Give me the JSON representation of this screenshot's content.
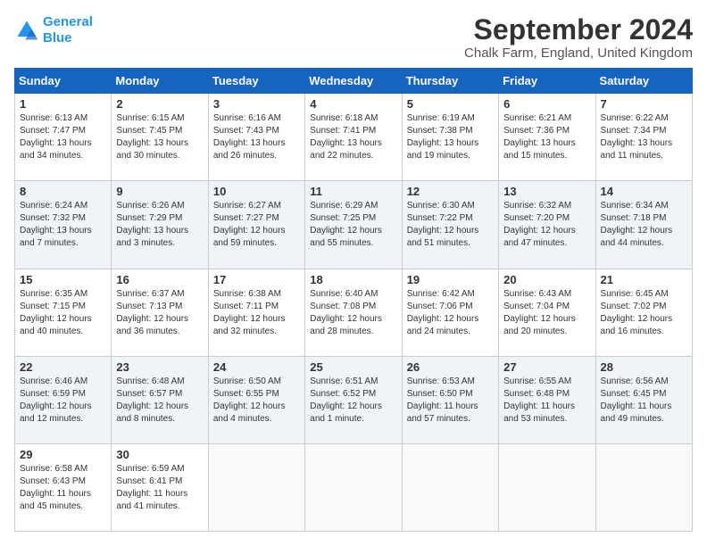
{
  "logo": {
    "line1": "General",
    "line2": "Blue"
  },
  "title": "September 2024",
  "location": "Chalk Farm, England, United Kingdom",
  "weekdays": [
    "Sunday",
    "Monday",
    "Tuesday",
    "Wednesday",
    "Thursday",
    "Friday",
    "Saturday"
  ],
  "rows": [
    [
      {
        "day": "1",
        "info": "Sunrise: 6:13 AM\nSunset: 7:47 PM\nDaylight: 13 hours\nand 34 minutes."
      },
      {
        "day": "2",
        "info": "Sunrise: 6:15 AM\nSunset: 7:45 PM\nDaylight: 13 hours\nand 30 minutes."
      },
      {
        "day": "3",
        "info": "Sunrise: 6:16 AM\nSunset: 7:43 PM\nDaylight: 13 hours\nand 26 minutes."
      },
      {
        "day": "4",
        "info": "Sunrise: 6:18 AM\nSunset: 7:41 PM\nDaylight: 13 hours\nand 22 minutes."
      },
      {
        "day": "5",
        "info": "Sunrise: 6:19 AM\nSunset: 7:38 PM\nDaylight: 13 hours\nand 19 minutes."
      },
      {
        "day": "6",
        "info": "Sunrise: 6:21 AM\nSunset: 7:36 PM\nDaylight: 13 hours\nand 15 minutes."
      },
      {
        "day": "7",
        "info": "Sunrise: 6:22 AM\nSunset: 7:34 PM\nDaylight: 13 hours\nand 11 minutes."
      }
    ],
    [
      {
        "day": "8",
        "info": "Sunrise: 6:24 AM\nSunset: 7:32 PM\nDaylight: 13 hours\nand 7 minutes."
      },
      {
        "day": "9",
        "info": "Sunrise: 6:26 AM\nSunset: 7:29 PM\nDaylight: 13 hours\nand 3 minutes."
      },
      {
        "day": "10",
        "info": "Sunrise: 6:27 AM\nSunset: 7:27 PM\nDaylight: 12 hours\nand 59 minutes."
      },
      {
        "day": "11",
        "info": "Sunrise: 6:29 AM\nSunset: 7:25 PM\nDaylight: 12 hours\nand 55 minutes."
      },
      {
        "day": "12",
        "info": "Sunrise: 6:30 AM\nSunset: 7:22 PM\nDaylight: 12 hours\nand 51 minutes."
      },
      {
        "day": "13",
        "info": "Sunrise: 6:32 AM\nSunset: 7:20 PM\nDaylight: 12 hours\nand 47 minutes."
      },
      {
        "day": "14",
        "info": "Sunrise: 6:34 AM\nSunset: 7:18 PM\nDaylight: 12 hours\nand 44 minutes."
      }
    ],
    [
      {
        "day": "15",
        "info": "Sunrise: 6:35 AM\nSunset: 7:15 PM\nDaylight: 12 hours\nand 40 minutes."
      },
      {
        "day": "16",
        "info": "Sunrise: 6:37 AM\nSunset: 7:13 PM\nDaylight: 12 hours\nand 36 minutes."
      },
      {
        "day": "17",
        "info": "Sunrise: 6:38 AM\nSunset: 7:11 PM\nDaylight: 12 hours\nand 32 minutes."
      },
      {
        "day": "18",
        "info": "Sunrise: 6:40 AM\nSunset: 7:08 PM\nDaylight: 12 hours\nand 28 minutes."
      },
      {
        "day": "19",
        "info": "Sunrise: 6:42 AM\nSunset: 7:06 PM\nDaylight: 12 hours\nand 24 minutes."
      },
      {
        "day": "20",
        "info": "Sunrise: 6:43 AM\nSunset: 7:04 PM\nDaylight: 12 hours\nand 20 minutes."
      },
      {
        "day": "21",
        "info": "Sunrise: 6:45 AM\nSunset: 7:02 PM\nDaylight: 12 hours\nand 16 minutes."
      }
    ],
    [
      {
        "day": "22",
        "info": "Sunrise: 6:46 AM\nSunset: 6:59 PM\nDaylight: 12 hours\nand 12 minutes."
      },
      {
        "day": "23",
        "info": "Sunrise: 6:48 AM\nSunset: 6:57 PM\nDaylight: 12 hours\nand 8 minutes."
      },
      {
        "day": "24",
        "info": "Sunrise: 6:50 AM\nSunset: 6:55 PM\nDaylight: 12 hours\nand 4 minutes."
      },
      {
        "day": "25",
        "info": "Sunrise: 6:51 AM\nSunset: 6:52 PM\nDaylight: 12 hours\nand 1 minute."
      },
      {
        "day": "26",
        "info": "Sunrise: 6:53 AM\nSunset: 6:50 PM\nDaylight: 11 hours\nand 57 minutes."
      },
      {
        "day": "27",
        "info": "Sunrise: 6:55 AM\nSunset: 6:48 PM\nDaylight: 11 hours\nand 53 minutes."
      },
      {
        "day": "28",
        "info": "Sunrise: 6:56 AM\nSunset: 6:45 PM\nDaylight: 11 hours\nand 49 minutes."
      }
    ],
    [
      {
        "day": "29",
        "info": "Sunrise: 6:58 AM\nSunset: 6:43 PM\nDaylight: 11 hours\nand 45 minutes."
      },
      {
        "day": "30",
        "info": "Sunrise: 6:59 AM\nSunset: 6:41 PM\nDaylight: 11 hours\nand 41 minutes."
      },
      null,
      null,
      null,
      null,
      null
    ]
  ]
}
